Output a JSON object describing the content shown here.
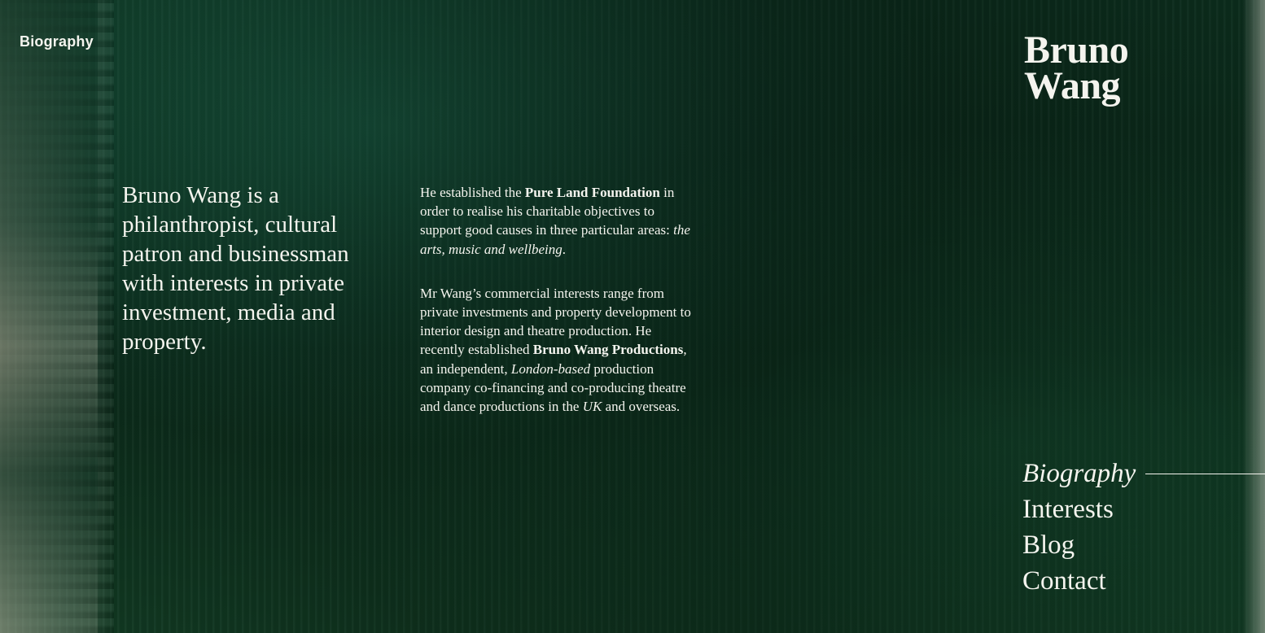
{
  "page_label": "Biography",
  "logo": {
    "line1": "Bruno",
    "line2": "Wang"
  },
  "intro": "Bruno Wang is a philanthropist, cultural patron and businessman with interests in private investment, media and property.",
  "para1": {
    "t1": "He established the ",
    "b1": "Pure Land Foundation",
    "t2": " in order to realise his charitable objectives to support good causes in three particular areas: ",
    "i1": "the arts, music and wellbeing",
    "t3": "."
  },
  "para2": {
    "t1": "Mr Wang’s commercial interests range from private investments and property development to interior design and theatre production. He recently established ",
    "b1": "Bruno Wang Productions",
    "t2": ", an independent, ",
    "i1": "London-based",
    "t3": " production company co-financing and co-producing theatre and dance productions in the ",
    "i2": "UK",
    "t4": " and overseas."
  },
  "nav": {
    "items": [
      {
        "label": "Biography",
        "active": true
      },
      {
        "label": "Interests"
      },
      {
        "label": "Blog"
      },
      {
        "label": "Contact"
      }
    ]
  }
}
